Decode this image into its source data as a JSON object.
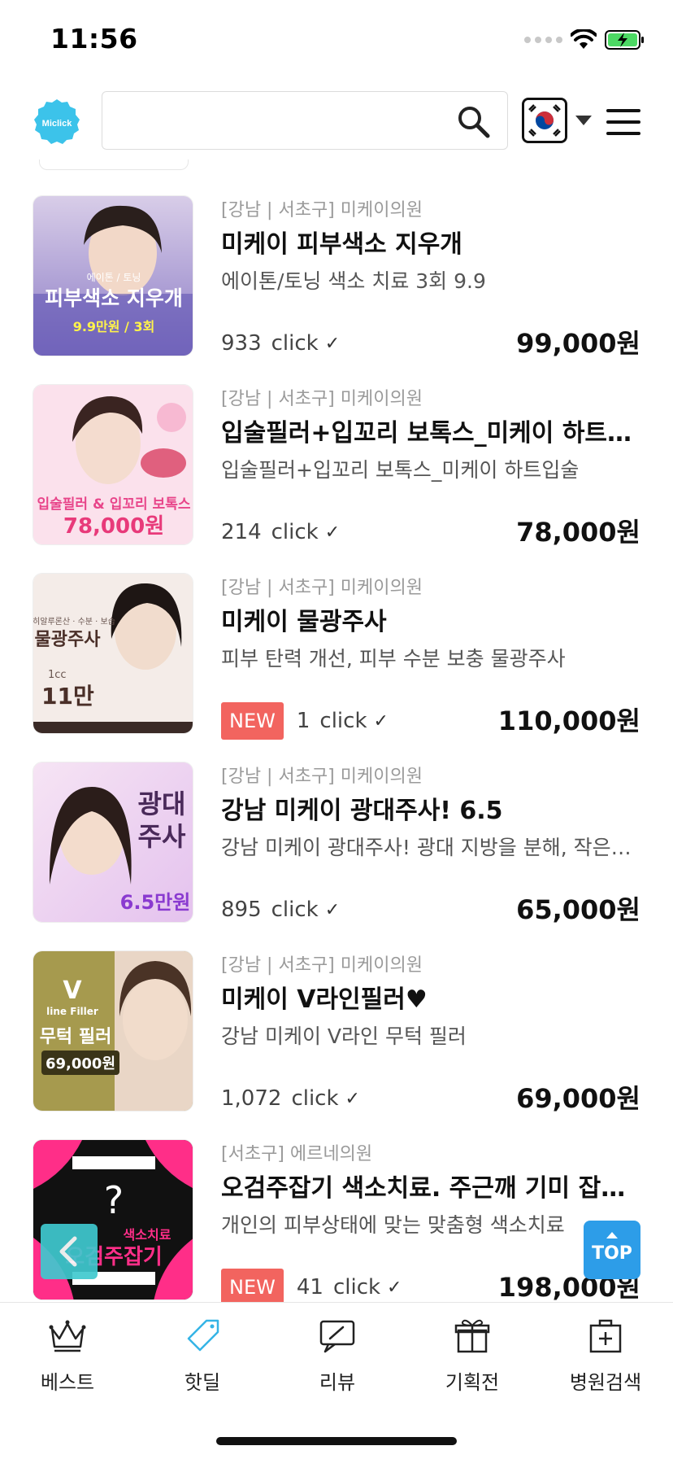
{
  "status_bar": {
    "time": "11:56"
  },
  "header": {
    "logo_text": "Miclick",
    "search_placeholder": "",
    "flag": "south-korea-flag"
  },
  "deals": [
    {
      "location": "[강남 | 서초구] 미케이의원",
      "title": "미케이 피부색소 지우개",
      "subtitle": "에이톤/토닝 색소 치료 3회 9.9",
      "clicks": "933",
      "click_label": "click",
      "is_new": false,
      "price": "99,000원",
      "thumb": {
        "line1": "에이톤 / 토닝",
        "line2": "피부색소 지우개",
        "line3": "9.9만원 / 3회"
      }
    },
    {
      "location": "[강남 | 서초구] 미케이의원",
      "title": "입술필러+입꼬리 보톡스_미케이 하트…",
      "subtitle": "입술필러+입꼬리 보톡스_미케이 하트입술",
      "clicks": "214",
      "click_label": "click",
      "is_new": false,
      "price": "78,000원",
      "thumb": {
        "line1": "입술필러 & 입꼬리 보톡스",
        "line2": "78,000원"
      }
    },
    {
      "location": "[강남 | 서초구] 미케이의원",
      "title": "미케이 물광주사",
      "subtitle": "피부 탄력 개선, 피부 수분 보충 물광주사",
      "clicks": "1",
      "click_label": "click",
      "is_new": true,
      "new_label": "NEW",
      "price": "110,000원",
      "thumb": {
        "line1": "히알루론산 · 수분 · 보습",
        "line2": "물광주사",
        "line3": "1cc",
        "line4": "11만"
      }
    },
    {
      "location": "[강남 | 서초구] 미케이의원",
      "title": "강남 미케이 광대주사! 6.5",
      "subtitle": "강남 미케이 광대주사! 광대 지방을 분해, 작은…",
      "clicks": "895",
      "click_label": "click",
      "is_new": false,
      "price": "65,000원",
      "thumb": {
        "line1": "광대",
        "line2": "주사",
        "line3": "6.5만원"
      }
    },
    {
      "location": "[강남 | 서초구] 미케이의원",
      "title": "미케이 V라인필러♥",
      "subtitle": "강남 미케이 V라인 무턱 필러",
      "clicks": "1,072",
      "click_label": "click",
      "is_new": false,
      "price": "69,000원",
      "thumb": {
        "line1": "V",
        "line2": "line Filler",
        "line3": "무턱 필러",
        "line4": "69,000원"
      }
    },
    {
      "location": "[서초구] 에르네의원",
      "title": "오검주잡기 색소치료. 주근깨 기미 잡티 …",
      "subtitle": "개인의 피부상태에 맞는 맞춤형 색소치료",
      "clicks": "41",
      "click_label": "click",
      "is_new": true,
      "new_label": "NEW",
      "price": "198,000원",
      "thumb": {
        "line1": "?",
        "line2": "색소치료",
        "line3": "오검주잡기"
      }
    }
  ],
  "floating": {
    "top_label": "TOP"
  },
  "bottom_nav": [
    {
      "label": "베스트",
      "icon": "crown-icon"
    },
    {
      "label": "핫딜",
      "icon": "price-tag-icon",
      "active": true
    },
    {
      "label": "리뷰",
      "icon": "review-pen-icon"
    },
    {
      "label": "기획전",
      "icon": "gift-icon"
    },
    {
      "label": "병원검색",
      "icon": "hospital-icon"
    }
  ],
  "colors": {
    "accent": "#3fc9cf",
    "new_badge": "#f2645f",
    "top_button": "#2d9de8",
    "active_nav": "#35b4e6"
  }
}
